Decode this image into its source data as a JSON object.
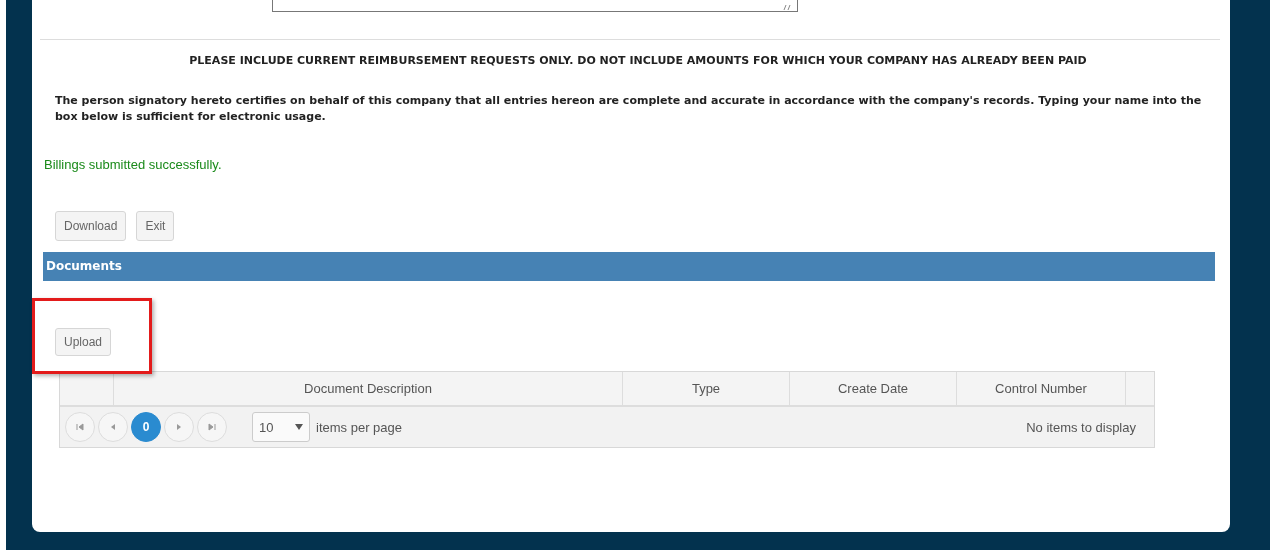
{
  "notice": "PLEASE INCLUDE CURRENT REIMBURSEMENT REQUESTS ONLY. DO NOT INCLUDE AMOUNTS FOR WHICH YOUR COMPANY HAS ALREADY BEEN PAID",
  "certification": "The person signatory hereto certifies on behalf of this company that all entries hereon are complete and accurate in accordance with the company's records. Typing your name into the box below is sufficient for electronic usage.",
  "status_message": "Billings submitted successfully.",
  "buttons": [
    "Download",
    "Exit"
  ],
  "documents": {
    "title": "Documents",
    "upload_button": "Upload",
    "highlighted": true,
    "grid": {
      "columns": [
        "Document Description",
        "Type",
        "Create Date",
        "Control Number"
      ],
      "pager": {
        "pages": [
          {
            "label": "0",
            "selected": true
          }
        ],
        "page_size": "10",
        "page_size_label": "items per page",
        "info": "No items to display"
      }
    }
  }
}
